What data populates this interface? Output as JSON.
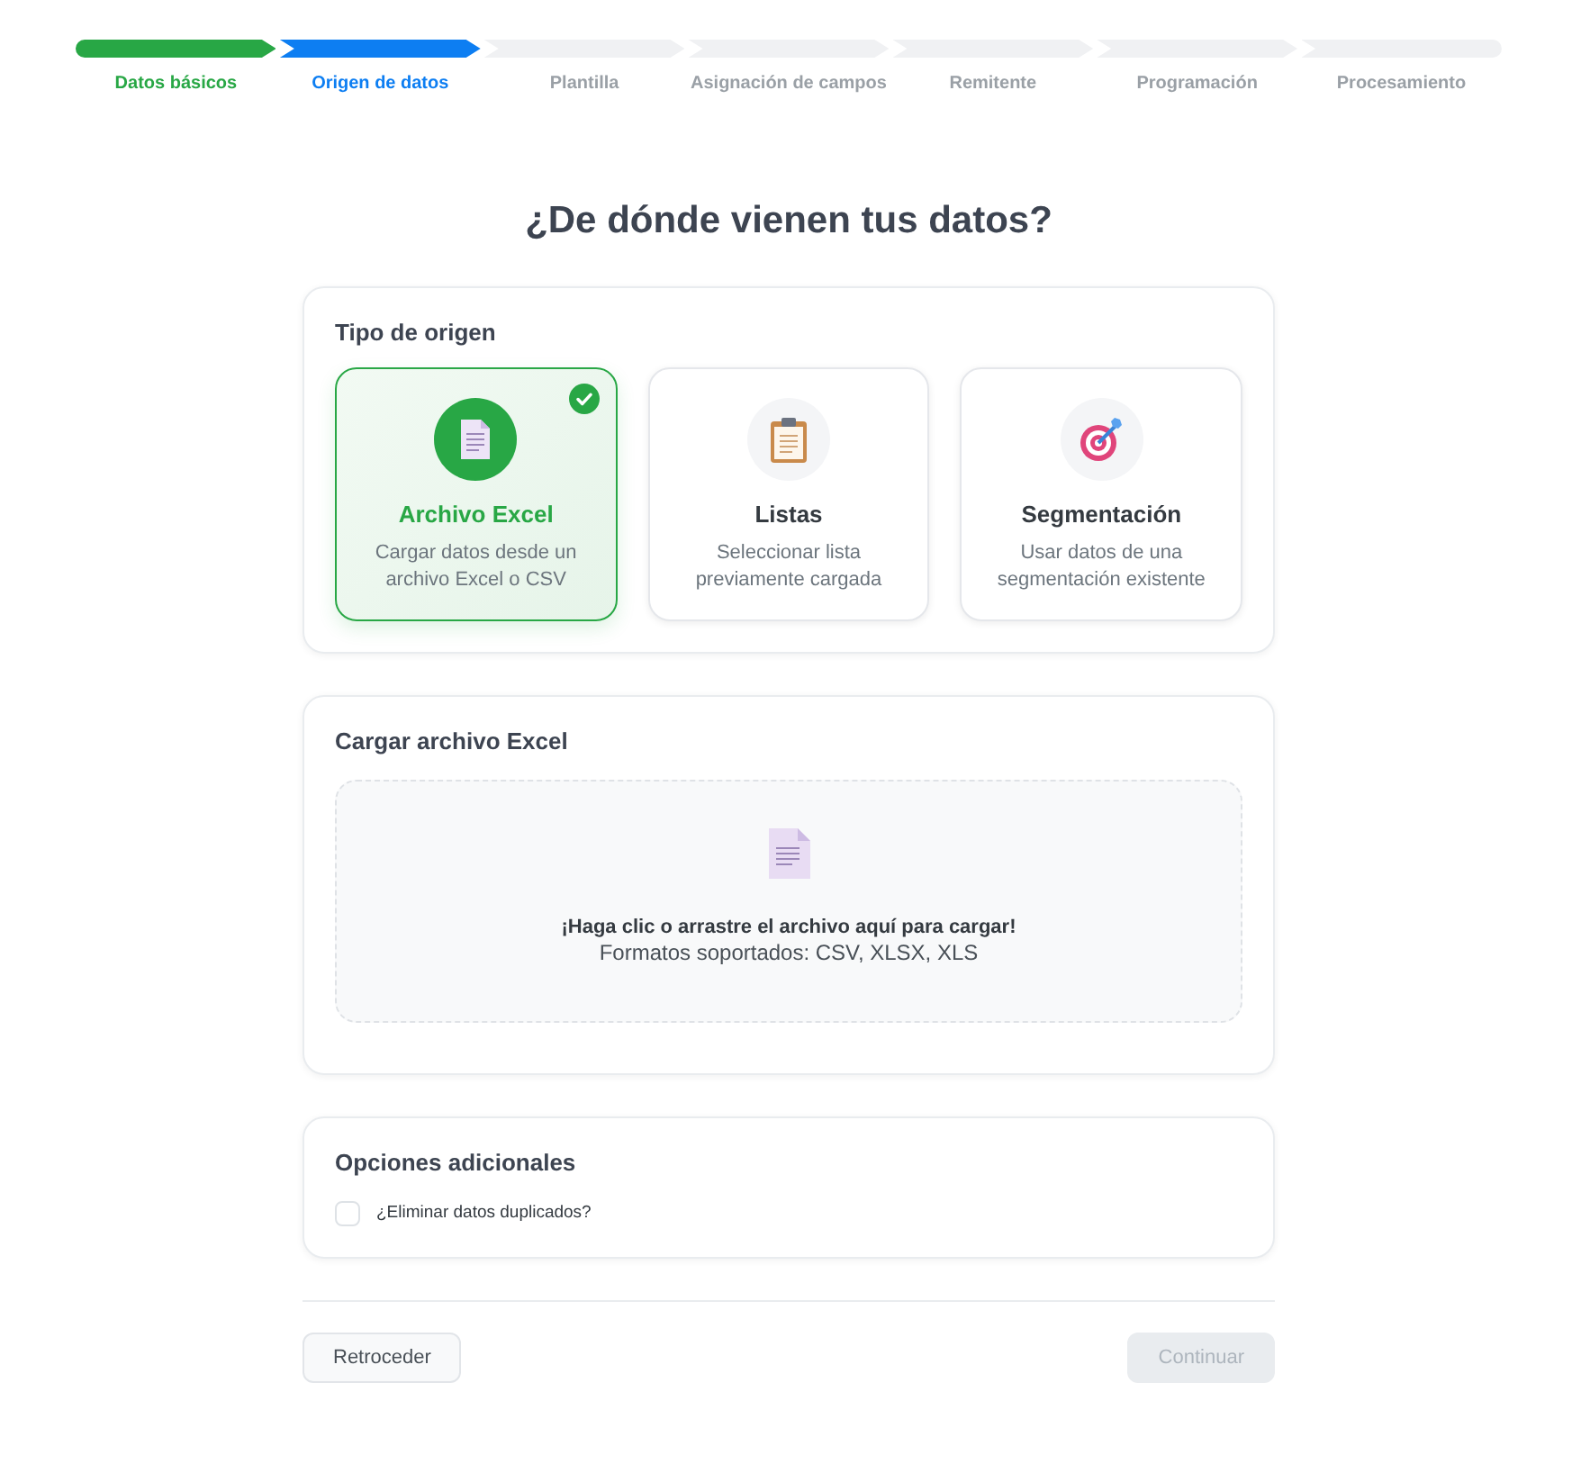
{
  "steps": [
    {
      "label": "Datos básicos",
      "completed": true,
      "selected": false
    },
    {
      "label": "Origen de datos",
      "completed": false,
      "selected": true
    },
    {
      "label": "Plantilla",
      "completed": false,
      "selected": false
    },
    {
      "label": "Asignación de campos",
      "completed": false,
      "selected": false
    },
    {
      "label": "Remitente",
      "completed": false,
      "selected": false
    },
    {
      "label": "Programación",
      "completed": false,
      "selected": false
    },
    {
      "label": "Procesamiento",
      "completed": false,
      "selected": false
    }
  ],
  "title": "¿De dónde vienen tus datos?",
  "source_section": {
    "title": "Tipo de origen",
    "options": [
      {
        "kind": "file",
        "title": "Archivo Excel",
        "description": "Cargar datos desde un archivo Excel o CSV",
        "selected": true
      },
      {
        "kind": "clipboard",
        "title": "Listas",
        "description": "Seleccionar lista previamente cargada",
        "selected": false
      },
      {
        "kind": "target",
        "title": "Segmentación",
        "description": "Usar datos de una segmentación existente",
        "selected": false
      }
    ]
  },
  "upload_section": {
    "title": "Cargar archivo Excel",
    "prompt": "¡Haga clic o arrastre el archivo aquí para cargar!",
    "formats": "Formatos soportados: CSV, XLSX, XLS"
  },
  "options_section": {
    "title": "Opciones adicionales",
    "checkboxes": [
      {
        "label": "¿Eliminar datos duplicados?",
        "checked": false
      }
    ]
  },
  "buttons": {
    "back": {
      "label": "Retroceder",
      "disabled": false
    },
    "next": {
      "label": "Continuar",
      "disabled": true
    }
  }
}
